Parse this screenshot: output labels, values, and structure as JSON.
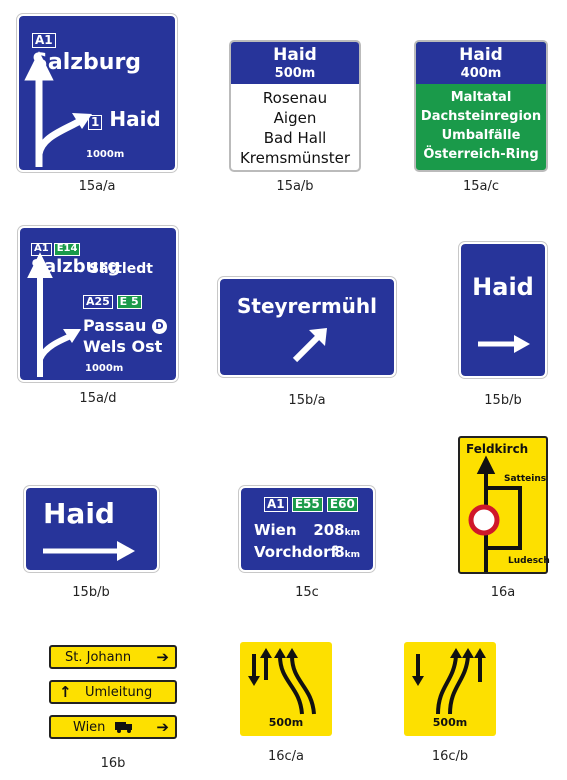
{
  "signs": {
    "s15aa": {
      "caption": "15a/a",
      "route": "A1",
      "dest": "Salzburg",
      "exit_num": "1",
      "exit_name": "Haid",
      "dist": "1000m"
    },
    "s15ab": {
      "caption": "15a/b",
      "title": "Haid",
      "dist": "500m",
      "lines": [
        "Rosenau",
        "Aigen",
        "Bad Hall",
        "Kremsmünster"
      ]
    },
    "s15ac": {
      "caption": "15a/c",
      "title": "Haid",
      "dist": "400m",
      "lines": [
        "Maltatal",
        "Dachsteinregion",
        "Umbalfälle",
        "Österreich-Ring"
      ]
    },
    "s15ad": {
      "caption": "15a/d",
      "route1": "A1",
      "euro1": "E14",
      "dest1": "Salzburg",
      "dest1b": "Sattledt",
      "route2": "A25",
      "euro2": "E 5",
      "dest2": "Passau",
      "country": "D",
      "dest2b": "Wels Ost",
      "dist": "1000m"
    },
    "s15ba": {
      "caption": "15b/a",
      "dest": "Steyrermühl"
    },
    "s15bb1": {
      "caption": "15b/b",
      "dest": "Haid"
    },
    "s15bb2": {
      "caption": "15b/b",
      "dest": "Haid"
    },
    "s15c": {
      "caption": "15c",
      "route": "A1",
      "euro1": "E55",
      "euro2": "E60",
      "dest1": "Wien",
      "km1": "208",
      "dest2": "Vorchdorf",
      "km2": "8",
      "unit": "km"
    },
    "s16a": {
      "caption": "16a",
      "dest1": "Feldkirch",
      "dest2": "Satteins",
      "dest3": "Ludesch"
    },
    "s16b": {
      "caption": "16b",
      "dest1": "St. Johann",
      "dest2": "Umleitung",
      "dest3": "Wien"
    },
    "s16ca": {
      "caption": "16c/a",
      "dist": "500m"
    },
    "s16cb": {
      "caption": "16c/b",
      "dist": "500m"
    }
  },
  "colors": {
    "blue": "#27349a",
    "green": "#1a9a4a",
    "yellow": "#fde000",
    "red": "#d0182a"
  }
}
